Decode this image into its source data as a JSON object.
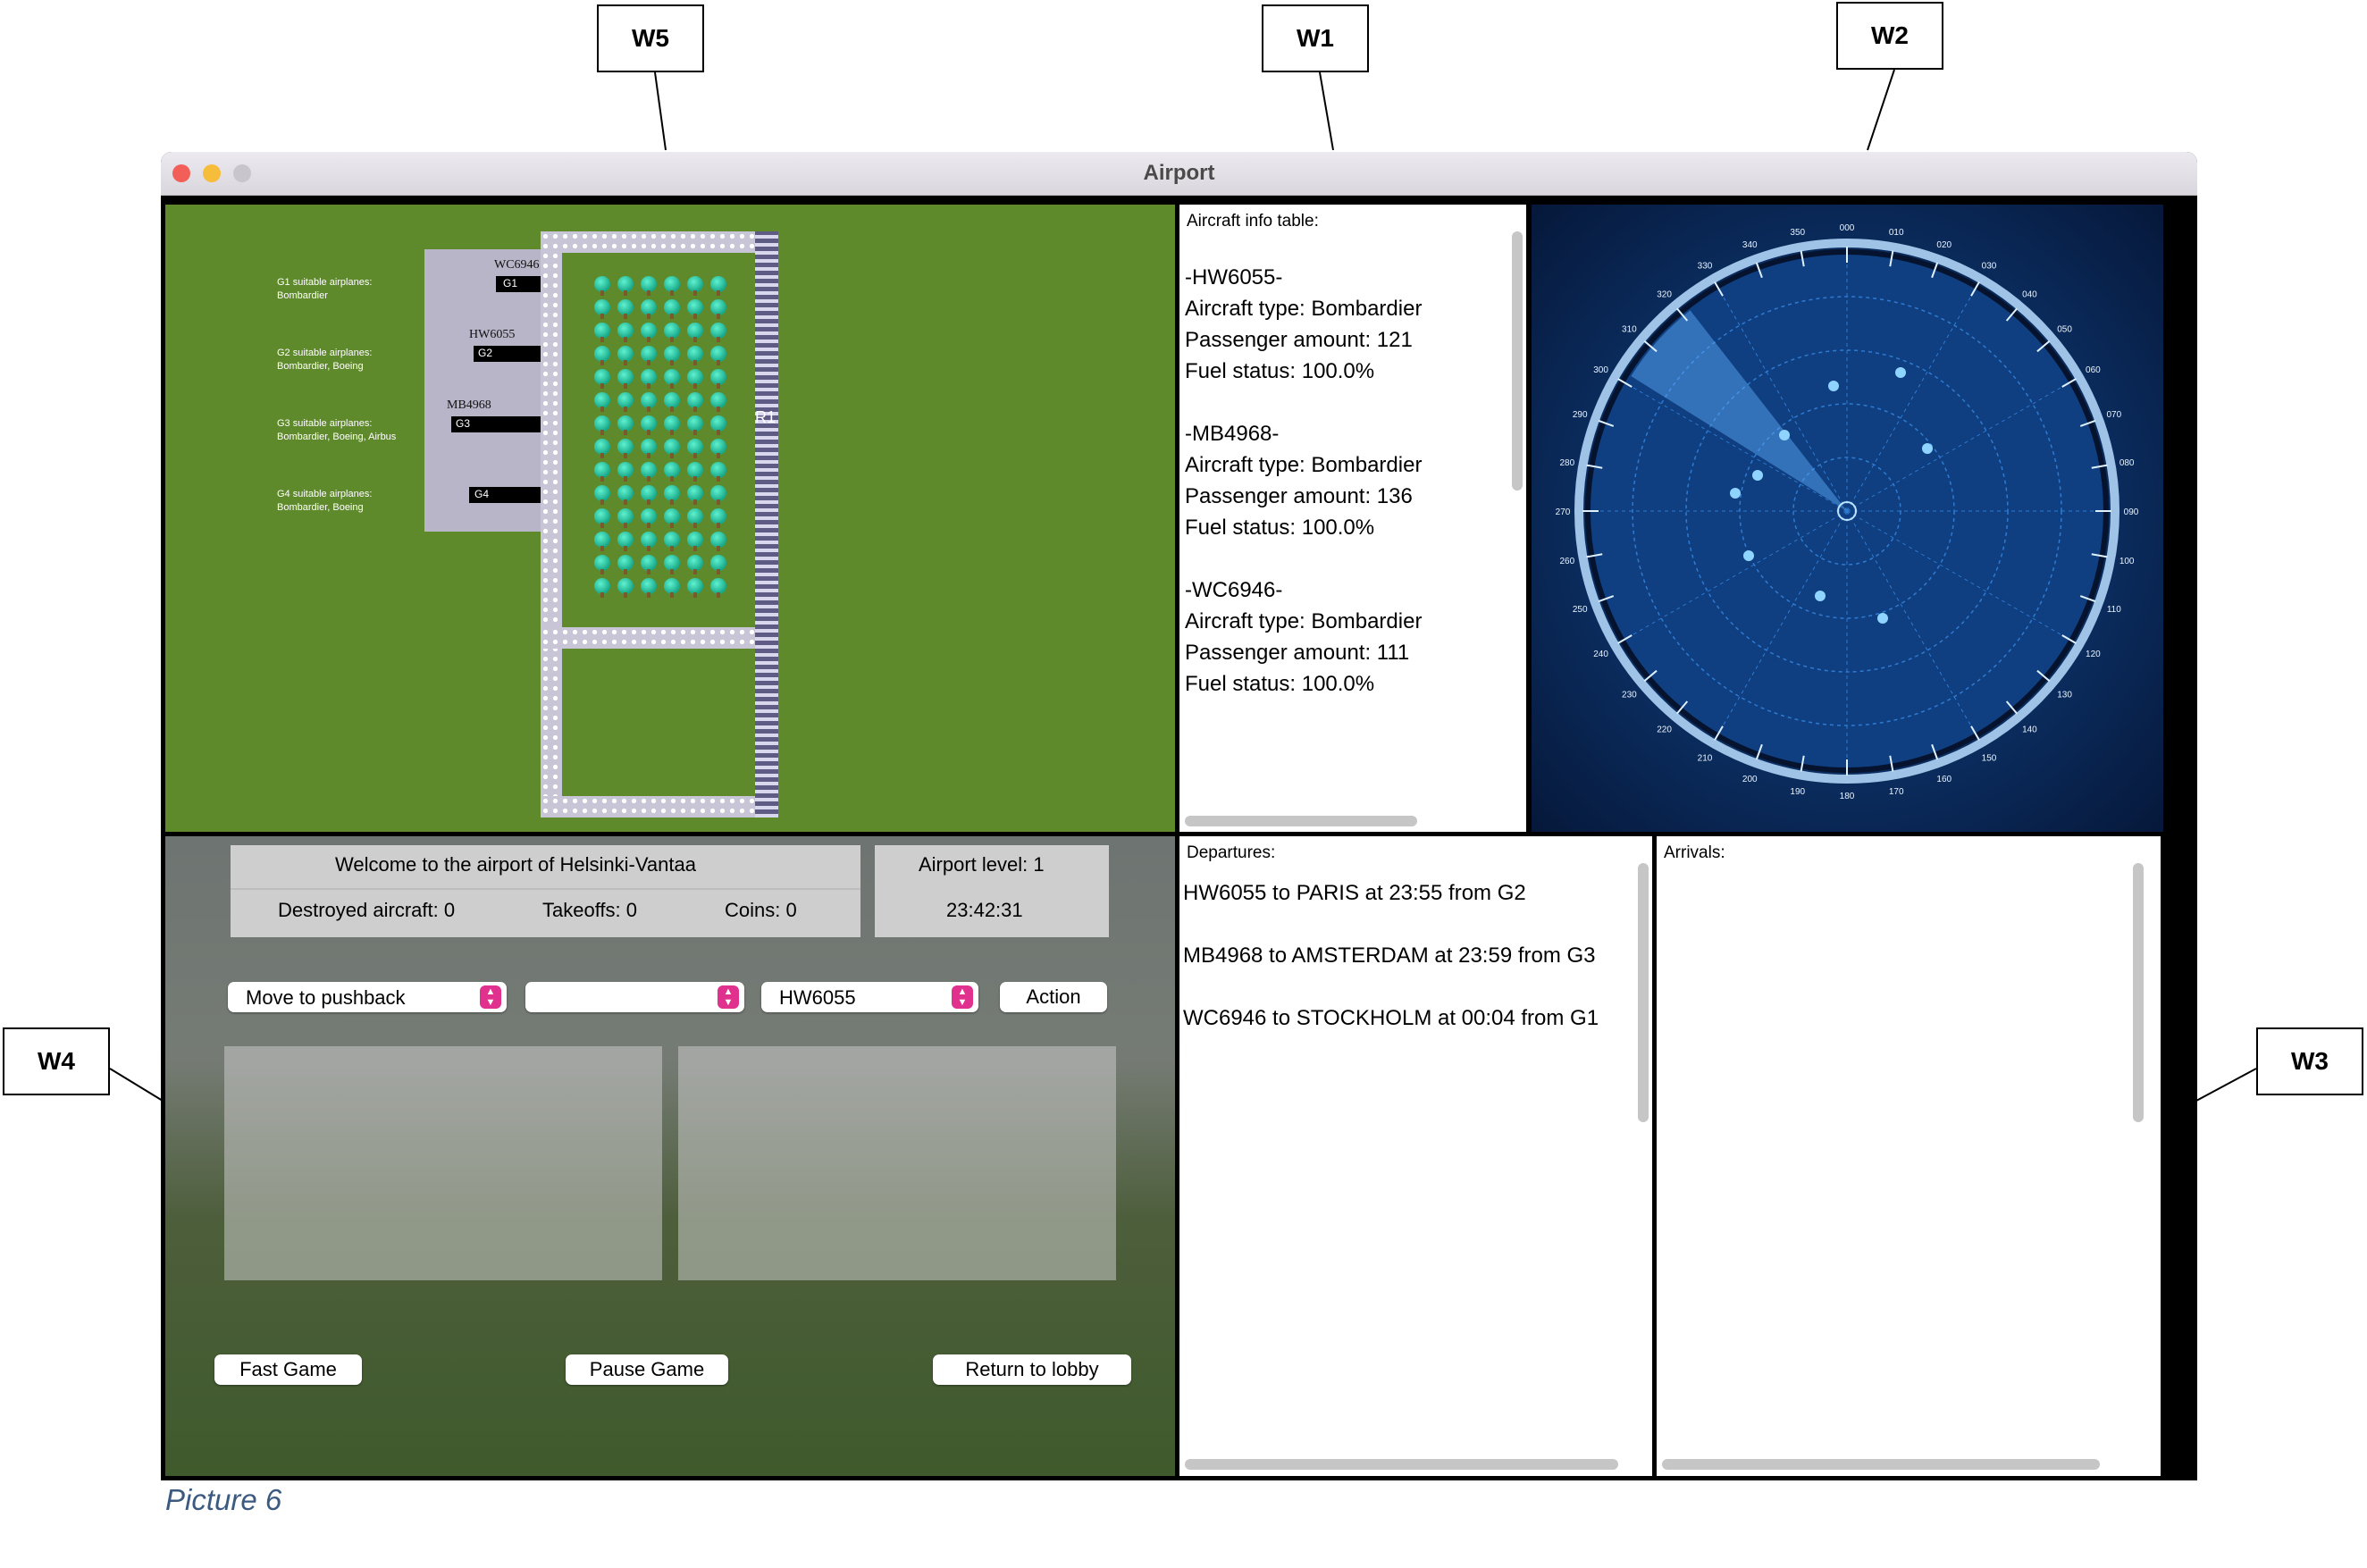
{
  "callouts": {
    "w5": "W5",
    "w1": "W1",
    "w2": "W2",
    "w4": "W4",
    "w3": "W3"
  },
  "window": {
    "title": "Airport"
  },
  "map": {
    "gate_info": [
      {
        "line1": "G1 suitable airplanes:",
        "line2": "Bombardier"
      },
      {
        "line1": "G2 suitable airplanes:",
        "line2": "Bombardier, Boeing"
      },
      {
        "line1": "G3 suitable airplanes:",
        "line2": "Bombardier, Boeing, Airbus"
      },
      {
        "line1": "G4 suitable airplanes:",
        "line2": "Bombardier, Boeing"
      }
    ],
    "gates": [
      "G1",
      "G2",
      "G3",
      "G4"
    ],
    "planes": [
      "WC6946",
      "HW6055",
      "MB4968"
    ],
    "runway_label": "R1"
  },
  "info": {
    "label": "Aircraft info table:",
    "aircraft": [
      {
        "id": "-HW6055-",
        "type": "Aircraft type: Bombardier",
        "passengers": "Passenger amount: 121",
        "fuel": "Fuel status: 100.0%"
      },
      {
        "id": "-MB4968-",
        "type": "Aircraft type: Bombardier",
        "passengers": "Passenger amount: 136",
        "fuel": "Fuel status: 100.0%"
      },
      {
        "id": "-WC6946-",
        "type": "Aircraft type: Bombardier",
        "passengers": "Passenger amount: 111",
        "fuel": "Fuel status: 100.0%"
      }
    ]
  },
  "radar": {
    "bearings": [
      "000",
      "010",
      "020",
      "030",
      "040",
      "050",
      "060",
      "070",
      "080",
      "090",
      "100",
      "110",
      "120",
      "130",
      "140",
      "150",
      "160",
      "170",
      "180",
      "190",
      "200",
      "210",
      "220",
      "230",
      "240",
      "250",
      "260",
      "270",
      "280",
      "290",
      "300",
      "310",
      "320",
      "330",
      "340",
      "350"
    ]
  },
  "control": {
    "welcome": "Welcome to the airport of Helsinki-Vantaa",
    "destroyed": "Destroyed aircraft: 0",
    "takeoffs": "Takeoffs: 0",
    "coins": "Coins:  0",
    "level": "Airport level:  1",
    "clock": "23:42:31",
    "action_select": "Move to pushback",
    "target_select": "",
    "flight_select": "HW6055",
    "action_button": "Action",
    "fast_button": "Fast Game",
    "pause_button": "Pause Game",
    "lobby_button": "Return to lobby"
  },
  "departures": {
    "label": "Departures:",
    "flights": [
      "HW6055 to PARIS at 23:55 from G2",
      "MB4968 to AMSTERDAM at 23:59 from G3",
      "WC6946 to STOCKHOLM at 00:04 from G1"
    ]
  },
  "arrivals": {
    "label": "Arrivals:"
  },
  "caption": "Picture 6"
}
